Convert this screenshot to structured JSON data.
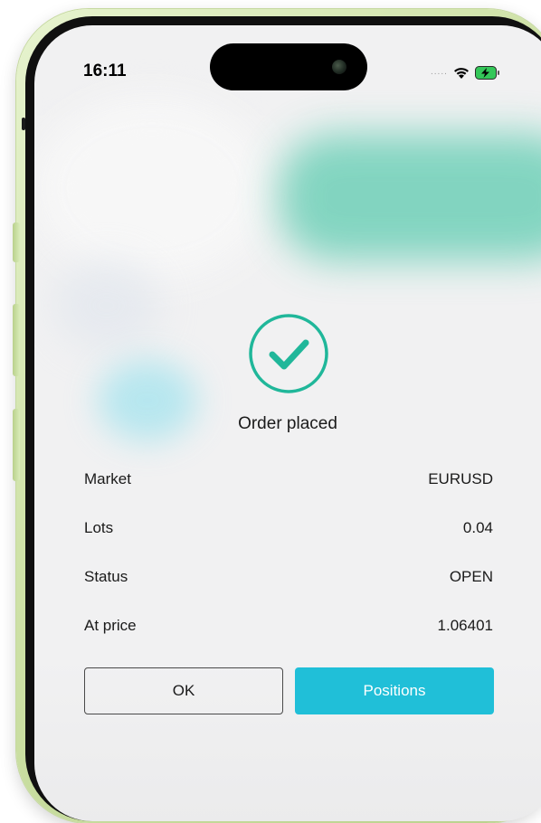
{
  "status_bar": {
    "time": "16:11",
    "signal_dots": "....."
  },
  "confirmation": {
    "icon": "checkmark-circle-icon",
    "title": "Order placed",
    "accent_color": "#20b79a"
  },
  "details": [
    {
      "label": "Market",
      "value": "EURUSD"
    },
    {
      "label": "Lots",
      "value": "0.04"
    },
    {
      "label": "Status",
      "value": "OPEN"
    },
    {
      "label": "At price",
      "value": "1.06401"
    }
  ],
  "buttons": {
    "ok_label": "OK",
    "positions_label": "Positions",
    "positions_color": "#20bfd8"
  }
}
